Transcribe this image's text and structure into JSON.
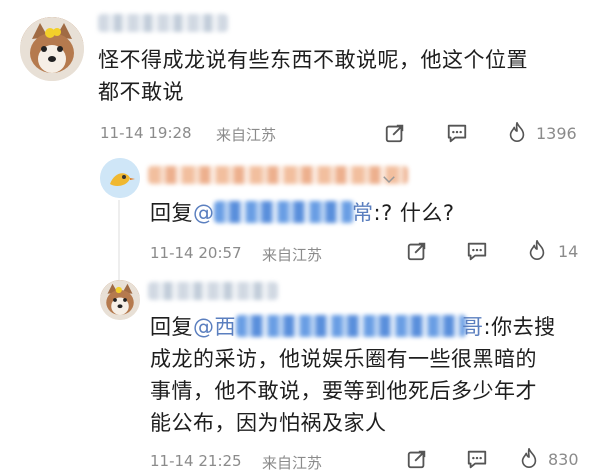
{
  "comments": [
    {
      "text": "怪不得成龙说有些东西不敢说呢，他这个位置都不敢说",
      "line1": "怪不得成龙说有些东西不敢说呢，他这个位置",
      "line2": "都不敢说",
      "time": "11-14 19:28",
      "location": "来自江苏",
      "likes": "1396"
    },
    {
      "reply_prefix": "回复",
      "mention_start": "@",
      "mention_end": "常",
      "text_after": ":? 什么?",
      "time": "11-14 20:57",
      "location": "来自江苏",
      "likes": "14"
    },
    {
      "reply_prefix": "回复",
      "mention_start": "@西",
      "mention_end": "哥",
      "text_after": ":你去搜",
      "line2": "成龙的采访，他说娱乐圈有一些很黑暗的",
      "line3": "事情，他不敢说，要等到他死后多少年才",
      "line4": "能公布，因为怕祸及家人",
      "time": "11-14 21:25",
      "location": "来自江苏",
      "likes": "830"
    }
  ],
  "icons": [
    "share-icon",
    "comment-icon",
    "like-flame-icon",
    "chevron-down-icon"
  ]
}
